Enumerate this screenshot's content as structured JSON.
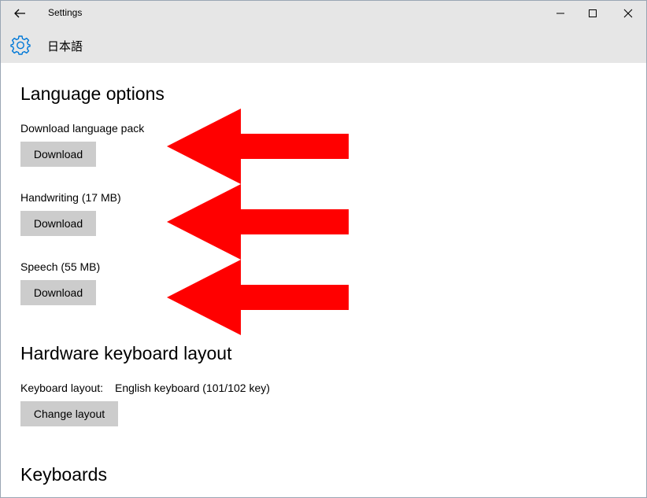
{
  "window": {
    "title": "Settings"
  },
  "header": {
    "page_title": "日本語"
  },
  "sections": {
    "language_options": {
      "title": "Language options",
      "items": [
        {
          "label": "Download language pack",
          "button": "Download"
        },
        {
          "label": "Handwriting (17 MB)",
          "button": "Download"
        },
        {
          "label": "Speech (55 MB)",
          "button": "Download"
        }
      ]
    },
    "hardware_keyboard": {
      "title": "Hardware keyboard layout",
      "layout_label": "Keyboard layout:",
      "layout_value": "English keyboard (101/102 key)",
      "button": "Change layout"
    },
    "keyboards": {
      "title": "Keyboards"
    }
  },
  "icons": {
    "back": "back-arrow-icon",
    "settings": "gear-icon",
    "minimize": "minimize-icon",
    "maximize": "maximize-icon",
    "close": "close-icon",
    "annotation": "red-arrow-icon"
  },
  "colors": {
    "titlebar_bg": "#e6e6e6",
    "accent": "#0078d7",
    "button_bg": "#cccccc",
    "annotation": "#ff0000"
  }
}
